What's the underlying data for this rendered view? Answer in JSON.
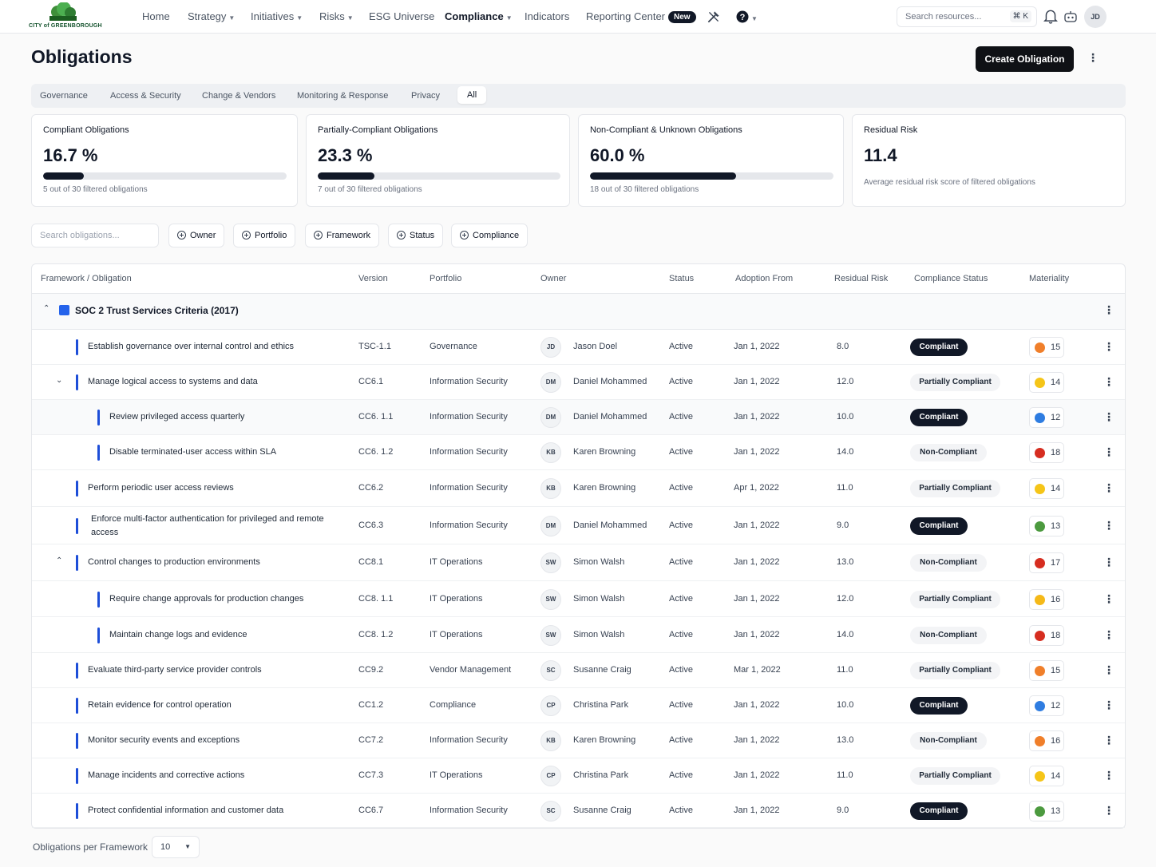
{
  "nav": {
    "logo_text": "CITY of GREENBOROUGH",
    "items": [
      "Home",
      "Strategy",
      "Initiatives",
      "Risks",
      "ESG Universe",
      "Compliance",
      "Indicators",
      "Reporting Center"
    ],
    "new_badge": "New",
    "search_placeholder": "Search resources...",
    "shortcut": "⌘ K",
    "user_initials": "JD"
  },
  "page": {
    "title": "Obligations",
    "create_button": "Create Obligation"
  },
  "tabs": [
    "Governance",
    "Access & Security",
    "Change & Vendors",
    "Monitoring & Response",
    "Privacy",
    "All"
  ],
  "stats": [
    {
      "label": "Compliant Obligations",
      "value": "16.7 %",
      "sub": "5 out of 30 filtered obligations",
      "fraction": 0.167
    },
    {
      "label": "Partially-Compliant Obligations",
      "value": "23.3 %",
      "sub": "7 out of 30 filtered obligations",
      "fraction": 0.233
    },
    {
      "label": "Non-Compliant & Unknown Obligations",
      "value": "60.0 %",
      "sub": "18 out of 30 filtered obligations",
      "fraction": 0.6
    },
    {
      "label": "Residual Risk",
      "value": "11.4",
      "sub": "Average residual risk score of filtered obligations"
    }
  ],
  "filters": {
    "search_placeholder": "Search obligations...",
    "buttons": [
      "Owner",
      "Portfolio",
      "Framework",
      "Status",
      "Compliance"
    ]
  },
  "table": {
    "headers": [
      "Framework / Obligation",
      "Version",
      "Portfolio",
      "Owner",
      "Status",
      "Adoption From",
      "Residual Risk",
      "Compliance Status",
      "Materiality"
    ],
    "group": "SOC 2 Trust Services Criteria (2017)",
    "rows": [
      {
        "name": "Establish governance over internal control and ethics",
        "version": "TSC-1.1",
        "portfolio": "Governance",
        "initials": "JD",
        "owner": "Jason Doel",
        "status": "Active",
        "adoption": "Jan 1, 2022",
        "risk": "8.0",
        "compliance": "Compliant",
        "mat_color": "#f07f2a",
        "mat": "15"
      },
      {
        "name": "Manage logical access to systems and data",
        "version": "CC6.1",
        "portfolio": "Information Security",
        "initials": "DM",
        "owner": "Daniel Mohammed",
        "status": "Active",
        "adoption": "Jan 1, 2022",
        "risk": "12.0",
        "compliance": "Partially Compliant",
        "mat_color": "#f5c518",
        "mat": "14"
      },
      {
        "name": "Review privileged access quarterly",
        "version": "CC6. 1.1",
        "portfolio": "Information Security",
        "initials": "DM",
        "owner": "Daniel Mohammed",
        "status": "Active",
        "adoption": "Jan 1, 2022",
        "risk": "10.0",
        "compliance": "Compliant",
        "mat_color": "#2f7de1",
        "mat": "12"
      },
      {
        "name": "Disable terminated-user access within SLA",
        "version": "CC6. 1.2",
        "portfolio": "Information Security",
        "initials": "KB",
        "owner": "Karen Browning",
        "status": "Active",
        "adoption": "Jan 1, 2022",
        "risk": "14.0",
        "compliance": "Non-Compliant",
        "mat_color": "#d62d20",
        "mat": "18"
      },
      {
        "name": "Perform periodic user access reviews",
        "version": "CC6.2",
        "portfolio": "Information Security",
        "initials": "KB",
        "owner": "Karen Browning",
        "status": "Active",
        "adoption": "Apr 1, 2022",
        "risk": "11.0",
        "compliance": "Partially Compliant",
        "mat_color": "#f5c518",
        "mat": "14"
      },
      {
        "name": "Enforce multi-factor authentication for privileged and remote access",
        "version": "CC6.3",
        "portfolio": "Information Security",
        "initials": "DM",
        "owner": "Daniel Mohammed",
        "status": "Active",
        "adoption": "Jan 1, 2022",
        "risk": "9.0",
        "compliance": "Compliant",
        "mat_color": "#4c9a3f",
        "mat": "13"
      },
      {
        "name": "Control changes to production environments",
        "version": "CC8.1",
        "portfolio": "IT Operations",
        "initials": "SW",
        "owner": "Simon Walsh",
        "status": "Active",
        "adoption": "Jan 1, 2022",
        "risk": "13.0",
        "compliance": "Non-Compliant",
        "mat_color": "#d62d20",
        "mat": "17"
      },
      {
        "name": "Require change approvals for production changes",
        "version": "CC8. 1.1",
        "portfolio": "IT Operations",
        "initials": "SW",
        "owner": "Simon Walsh",
        "status": "Active",
        "adoption": "Jan 1, 2022",
        "risk": "12.0",
        "compliance": "Partially Compliant",
        "mat_color": "#f5b918",
        "mat": "16"
      },
      {
        "name": "Maintain change logs and evidence",
        "version": "CC8. 1.2",
        "portfolio": "IT Operations",
        "initials": "SW",
        "owner": "Simon Walsh",
        "status": "Active",
        "adoption": "Jan 1, 2022",
        "risk": "14.0",
        "compliance": "Non-Compliant",
        "mat_color": "#d62d20",
        "mat": "18"
      },
      {
        "name": "Evaluate third-party service provider controls",
        "version": "CC9.2",
        "portfolio": "Vendor Management",
        "initials": "SC",
        "owner": "Susanne Craig",
        "status": "Active",
        "adoption": "Mar 1, 2022",
        "risk": "11.0",
        "compliance": "Partially Compliant",
        "mat_color": "#f07f2a",
        "mat": "15"
      },
      {
        "name": "Retain evidence for control operation",
        "version": "CC1.2",
        "portfolio": "Compliance",
        "initials": "CP",
        "owner": "Christina Park",
        "status": "Active",
        "adoption": "Jan 1, 2022",
        "risk": "10.0",
        "compliance": "Compliant",
        "mat_color": "#2f7de1",
        "mat": "12"
      },
      {
        "name": "Monitor security events and exceptions",
        "version": "CC7.2",
        "portfolio": "Information Security",
        "initials": "KB",
        "owner": "Karen Browning",
        "status": "Active",
        "adoption": "Jan 1, 2022",
        "risk": "13.0",
        "compliance": "Non-Compliant",
        "mat_color": "#f07f2a",
        "mat": "16"
      },
      {
        "name": "Manage incidents and corrective actions",
        "version": "CC7.3",
        "portfolio": "IT Operations",
        "initials": "CP",
        "owner": "Christina Park",
        "status": "Active",
        "adoption": "Jan 1, 2022",
        "risk": "11.0",
        "compliance": "Partially Compliant",
        "mat_color": "#f5c518",
        "mat": "14"
      },
      {
        "name": "Protect confidential information and customer data",
        "version": "CC6.7",
        "portfolio": "Information Security",
        "initials": "SC",
        "owner": "Susanne Craig",
        "status": "Active",
        "adoption": "Jan 1, 2022",
        "risk": "9.0",
        "compliance": "Compliant",
        "mat_color": "#4c9a3f",
        "mat": "13"
      }
    ]
  },
  "footer": {
    "label": "Obligations per Framework",
    "page_size": "10"
  }
}
